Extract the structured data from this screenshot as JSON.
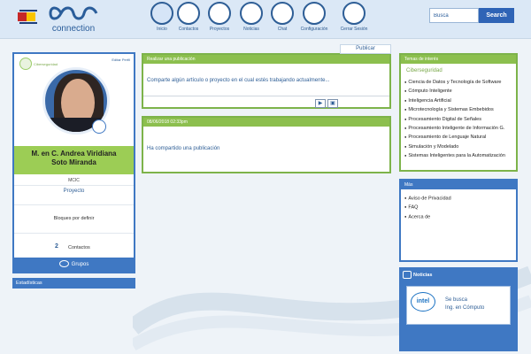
{
  "header": {
    "brand": "connection",
    "nav": [
      {
        "label": "Inicio",
        "icon": "home-icon",
        "active": true
      },
      {
        "label": "Contactos",
        "icon": "contacts-icon"
      },
      {
        "label": "Proyectos",
        "icon": "projects-icon"
      },
      {
        "label": "Noticias",
        "icon": "news-icon"
      },
      {
        "label": "Chat",
        "icon": "chat-icon"
      },
      {
        "label": "Configuración",
        "icon": "gear-icon"
      },
      {
        "label": "Cerrar Sesión",
        "icon": "power-icon"
      }
    ],
    "search": {
      "value": "Busca",
      "button": "Search"
    }
  },
  "profile": {
    "mini_logo_text": "Ciberseguridad",
    "edit_link": "Editar Perfil",
    "name_line1": "M. en C. Andrea Viridiana",
    "name_line2": "Soto Miranda",
    "program": "MCIC",
    "project_link": "Proyecto",
    "blocked_text": "Bloques por definir",
    "contacts_count": "2",
    "contacts_label": "Contactos",
    "groups_label": "Grupos",
    "stats_label": "Estadísticas"
  },
  "post": {
    "head": "Realizar una publicación",
    "placeholder": "Comparte algún artículo o proyecto en el cual estés trabajando actualmente...",
    "publish": "Publicar"
  },
  "timeline": {
    "head": "08/06/2018  02:33pm",
    "message": "Ha compartido una publicación"
  },
  "interests": {
    "head": "Temas de interés",
    "title": "Ciberseguridad",
    "items": [
      "Ciencia de Datos y Tecnología de Software",
      "Cómputo Inteligente",
      "Inteligencia Artificial",
      "Microtecnología y Sistemas Embebidos",
      "Procesamiento Digital de Señales",
      "Procesamiento Inteligente de Información G.",
      "Procesamiento de Lenguaje Natural",
      "Simulación y Modelado",
      "Sistemas Inteligentes para la Automatización"
    ]
  },
  "more": {
    "head": "Más",
    "items": [
      "Aviso de Privacidad",
      "FAQ",
      "Acerca de"
    ]
  },
  "news": {
    "head": "Noticias",
    "logo_text": "intel",
    "line1": "Se busca",
    "line2": "Ing. en Cómputo"
  },
  "colors": {
    "accent": "#3f78c3",
    "green": "#8cbf4e",
    "header": "#dbe8f6"
  }
}
